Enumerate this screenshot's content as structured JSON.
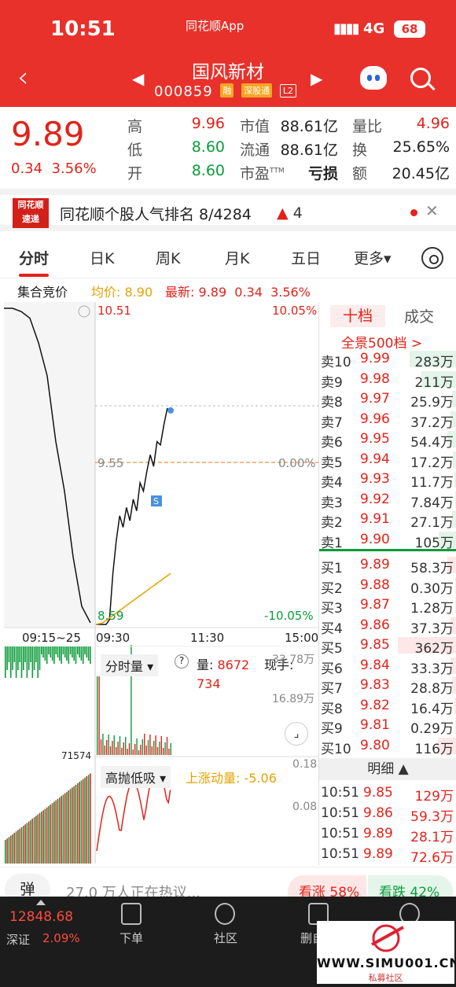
{
  "status": {
    "time": "10:51",
    "app": "同花顺App",
    "signal": "▮▮▮▮",
    "network": "4G",
    "battery": "68"
  },
  "nav": {
    "stock_name": "国风新材",
    "code": "000859",
    "tags": [
      "融",
      "深股通",
      "L2"
    ]
  },
  "quote": {
    "price": "9.89",
    "change": "0.34",
    "change_pct": "3.56%",
    "high_label": "高",
    "high": "9.96",
    "low_label": "低",
    "low": "8.60",
    "open_label": "开",
    "open": "8.60",
    "mktcap_label": "市值",
    "mktcap": "88.61亿",
    "float_label": "流通",
    "float": "88.61亿",
    "pe_label": "市盈",
    "pe_sup": "TTM",
    "pe": "亏损",
    "vr_label": "量比",
    "vr": "4.96",
    "turnover_label": "换",
    "turnover": "25.65%",
    "amount_label": "额",
    "amount": "20.45亿"
  },
  "news": {
    "logo_top": "同花顺",
    "logo_bottom": "速递",
    "text": "同花顺个股人气排名 8/4284",
    "rank_change": "4"
  },
  "tabs": [
    "分时",
    "日K",
    "周K",
    "月K",
    "五日",
    "更多▾"
  ],
  "info_line": {
    "auction": "集合竞价",
    "avg_label": "均价:",
    "avg": "8.90",
    "last_label": "最新:",
    "last": "9.89",
    "chg": "0.34",
    "chg_pct": "3.56%"
  },
  "chart_data": {
    "type": "line",
    "title": "",
    "y_labels": {
      "top": "10.51",
      "mid": "9.55",
      "bottom": "8.59"
    },
    "pct_labels": {
      "top": "10.05%",
      "mid": "0.00%",
      "bottom": "-10.05%"
    },
    "x_labels": [
      "09:15~25",
      "09:30",
      "11:30",
      "15:00"
    ],
    "auction_prices": [
      10.51,
      10.51,
      10.49,
      10.45,
      10.3,
      10.1,
      9.7,
      9.4,
      9.0,
      8.7,
      8.6
    ],
    "price_series": [
      8.59,
      8.59,
      8.59,
      8.59,
      8.62,
      8.9,
      9.1,
      9.25,
      9.18,
      9.3,
      9.22,
      9.35,
      9.28,
      9.45,
      9.4,
      9.52,
      9.62,
      9.55,
      9.7,
      9.68,
      9.8,
      9.9,
      9.89
    ],
    "avg_series": [
      8.59,
      8.6,
      8.63,
      8.66,
      8.69,
      8.72,
      8.75,
      8.78,
      8.81,
      8.84,
      8.87,
      8.9
    ]
  },
  "volume_panel": {
    "label": "分时量",
    "vol_label": "量:",
    "vol": "8672",
    "now_label": "现手:",
    "now": "734",
    "top": "33.78万",
    "mid": "16.89万",
    "left_value": "71574"
  },
  "indicator_panel": {
    "label": "高抛低吸",
    "name": "上涨动量:",
    "value": "-5.06",
    "top": "0.18",
    "mid": "0.08"
  },
  "book": {
    "tab_selected": "十档",
    "tab_other": "成交",
    "full": "全景500档 >",
    "asks": [
      {
        "label": "卖10",
        "price": "9.99",
        "vol": "283万",
        "level": 0.4
      },
      {
        "label": "卖9",
        "price": "9.98",
        "vol": "211万",
        "level": 0.3
      },
      {
        "label": "卖8",
        "price": "9.97",
        "vol": "25.9万",
        "level": 0.04
      },
      {
        "label": "卖7",
        "price": "9.96",
        "vol": "37.2万",
        "level": 0.05
      },
      {
        "label": "卖6",
        "price": "9.95",
        "vol": "54.4万",
        "level": 0.08
      },
      {
        "label": "卖5",
        "price": "9.94",
        "vol": "17.2万",
        "level": 0.03
      },
      {
        "label": "卖4",
        "price": "9.93",
        "vol": "11.7万",
        "level": 0.02
      },
      {
        "label": "卖3",
        "price": "9.92",
        "vol": "7.84万",
        "level": 0.01
      },
      {
        "label": "卖2",
        "price": "9.91",
        "vol": "27.1万",
        "level": 0.04
      },
      {
        "label": "卖1",
        "price": "9.90",
        "vol": "105万",
        "level": 0.15
      }
    ],
    "bids": [
      {
        "label": "买1",
        "price": "9.89",
        "vol": "58.3万",
        "level": 0.08
      },
      {
        "label": "买2",
        "price": "9.88",
        "vol": "0.30万",
        "level": 0.0
      },
      {
        "label": "买3",
        "price": "9.87",
        "vol": "1.28万",
        "level": 0.0
      },
      {
        "label": "买4",
        "price": "9.86",
        "vol": "37.3万",
        "level": 0.05
      },
      {
        "label": "买5",
        "price": "9.85",
        "vol": "362万",
        "level": 0.5
      },
      {
        "label": "买6",
        "price": "9.84",
        "vol": "33.3万",
        "level": 0.05
      },
      {
        "label": "买7",
        "price": "9.83",
        "vol": "28.8万",
        "level": 0.04
      },
      {
        "label": "买8",
        "price": "9.82",
        "vol": "16.4万",
        "level": 0.02
      },
      {
        "label": "买9",
        "price": "9.81",
        "vol": "0.29万",
        "level": 0.0
      },
      {
        "label": "买10",
        "price": "9.80",
        "vol": "116万",
        "level": 0.16
      }
    ],
    "detail_label": "明细 ▲",
    "trades": [
      {
        "time": "10:51",
        "price": "9.85",
        "vol": "129万"
      },
      {
        "time": "10:51",
        "price": "9.86",
        "vol": "59.3万"
      },
      {
        "time": "10:51",
        "price": "9.89",
        "vol": "28.1万"
      },
      {
        "time": "10:51",
        "price": "9.89",
        "vol": "72.6万"
      }
    ]
  },
  "hot": {
    "dan": "弹",
    "text": "27.0 万人正在热议...",
    "bull": "看涨 58%",
    "bear": "看跌 42%"
  },
  "bottom_nav": {
    "index_value": "12848.68",
    "index_name": "深证",
    "index_pct": "2.09%",
    "items": [
      "下单",
      "社区",
      "删自"
    ]
  },
  "watermark": {
    "site": "WWW.SIMU001.CN",
    "sub": "私募社区"
  }
}
